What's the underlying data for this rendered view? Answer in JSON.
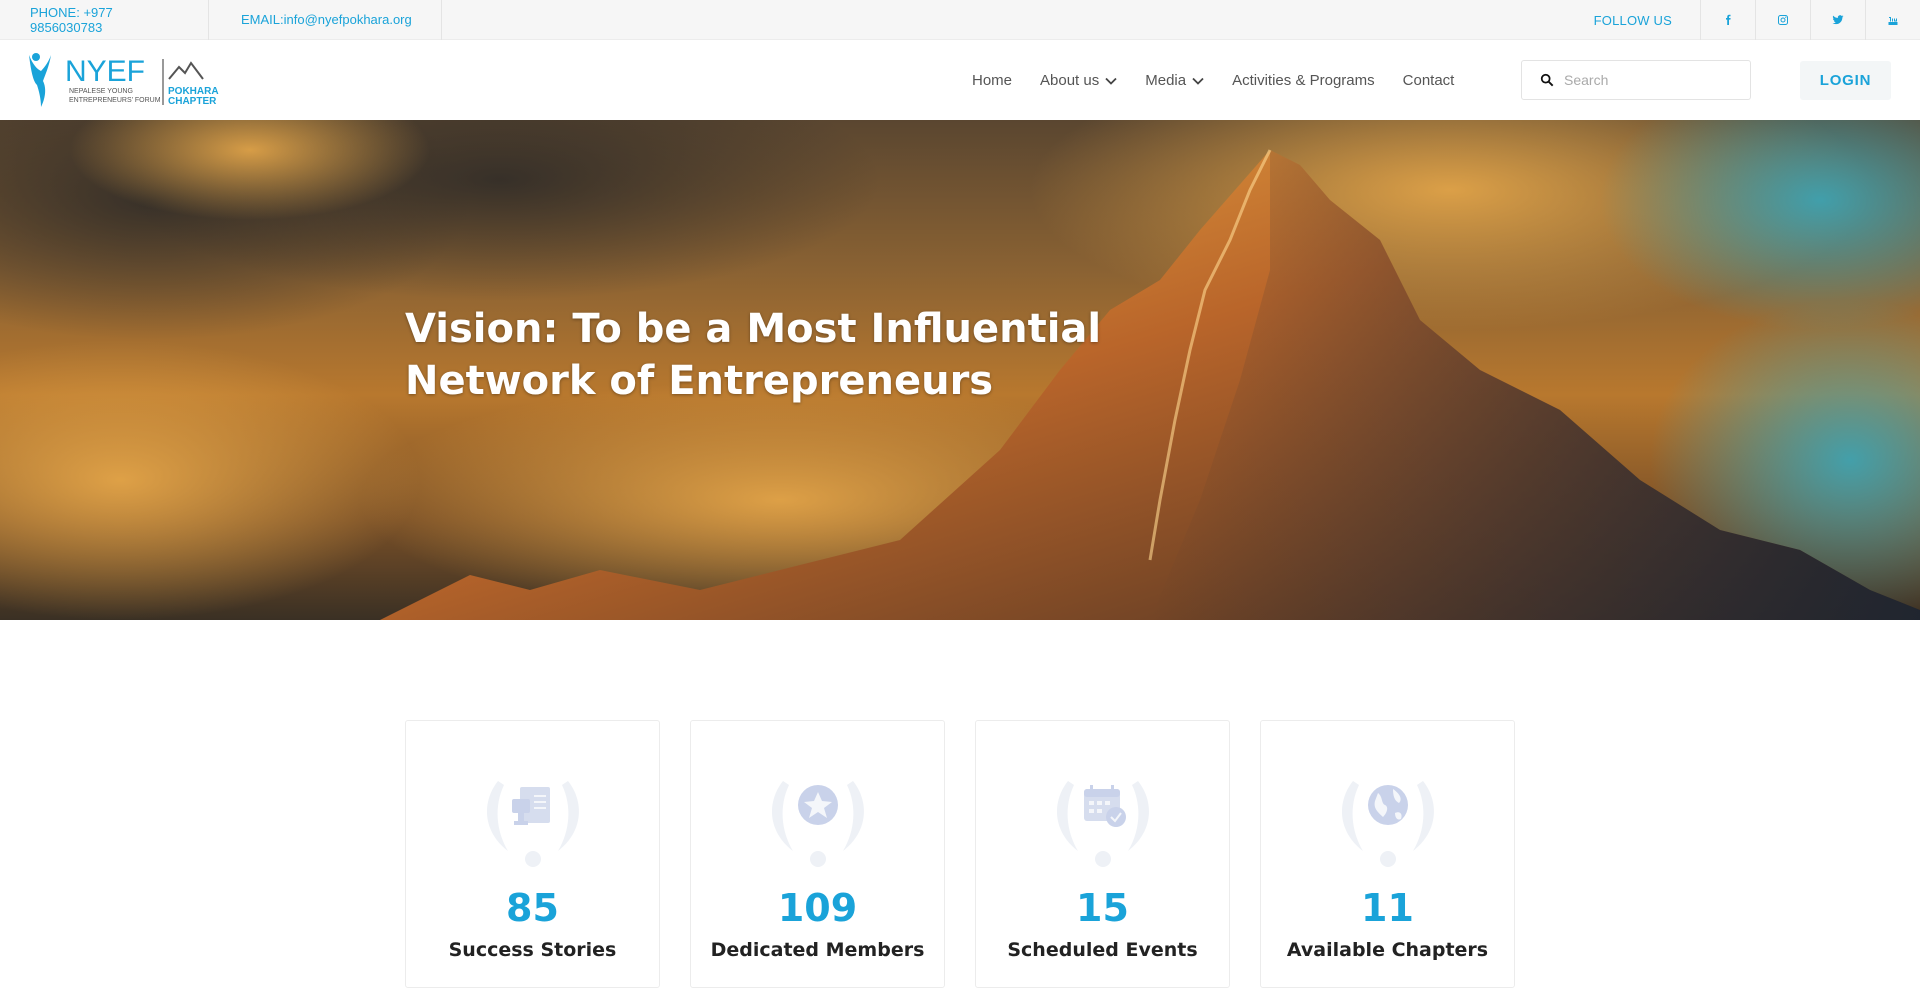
{
  "topbar": {
    "phone": "PHONE: +977 9856030783",
    "email": "EMAIL:info@nyefpokhara.org",
    "follow_label": "FOLLOW US",
    "social": [
      "facebook-icon",
      "instagram-icon",
      "twitter-icon",
      "youtube-icon"
    ]
  },
  "logo": {
    "brand": "NYEF",
    "line1": "NEPALESE YOUNG",
    "line2": "ENTREPRENEURS' FORUM",
    "chapter1": "POKHARA",
    "chapter2": "CHAPTER"
  },
  "nav": {
    "items": [
      {
        "label": "Home",
        "dropdown": false
      },
      {
        "label": "About us",
        "dropdown": true
      },
      {
        "label": "Media",
        "dropdown": true
      },
      {
        "label": "Activities & Programs",
        "dropdown": false
      },
      {
        "label": "Contact",
        "dropdown": false
      }
    ]
  },
  "search": {
    "placeholder": "Search"
  },
  "login": {
    "label": "LOGIN"
  },
  "hero": {
    "title_line1": "Vision: To be a Most Influential",
    "title_line2": "Network of Entrepreneurs"
  },
  "stats": [
    {
      "number": "85",
      "label": "Success Stories",
      "icon": "trophy-certificate-icon"
    },
    {
      "number": "109",
      "label": "Dedicated Members",
      "icon": "star-icon"
    },
    {
      "number": "15",
      "label": "Scheduled Events",
      "icon": "calendar-check-icon"
    },
    {
      "number": "11",
      "label": "Available Chapters",
      "icon": "globe-icon"
    }
  ],
  "colors": {
    "accent": "#1aa3d9",
    "badge": "#e8ecf4",
    "badge_icon": "#c9d2ea"
  }
}
